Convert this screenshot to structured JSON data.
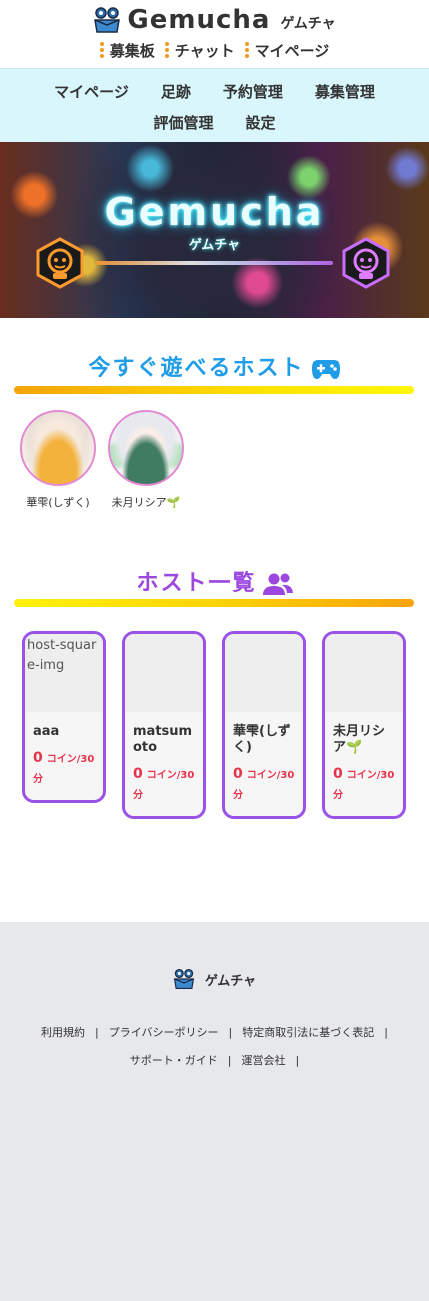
{
  "header": {
    "logo_text": "Gemucha",
    "logo_kana": "ゲムチャ",
    "links": [
      "募集板",
      "チャット",
      "マイページ"
    ]
  },
  "nav": {
    "row1": [
      "マイページ",
      "足跡",
      "予約管理",
      "募集管理"
    ],
    "row2": [
      "評価管理",
      "設定"
    ]
  },
  "banner": {
    "title": "Gemucha",
    "kana": "ゲムチャ"
  },
  "available": {
    "title": "今すぐ遊べるホスト",
    "hosts": [
      {
        "name": "華雫(しずく)"
      },
      {
        "name": "未月リシア🌱"
      }
    ]
  },
  "host_list": {
    "title": "ホスト一覧",
    "cards": [
      {
        "name": "aaa",
        "price": "0",
        "unit": "コイン/30分",
        "img_alt": "host-square-img"
      },
      {
        "name": "matsumoto",
        "price": "0",
        "unit": "コイン/30分"
      },
      {
        "name": "華雫(しずく)",
        "price": "0",
        "unit": "コイン/30分"
      },
      {
        "name": "未月リシア🌱",
        "price": "0",
        "unit": "コイン/30分"
      }
    ]
  },
  "footer": {
    "logo_text": "ゲムチャ",
    "links_row1": [
      "利用規約",
      "プライバシーポリシー",
      "特定商取引法に基づく表記"
    ],
    "links_row2": [
      "サポート・ガイド",
      "運営会社"
    ]
  },
  "colors": {
    "accent_orange": "#f39a1e",
    "nav_bg": "#d9f6fc",
    "title_blue": "#1f9de8",
    "title_purple": "#9b47e0",
    "card_border": "#9b52e6",
    "price_red": "#e8324a",
    "footer_bg": "#e7e8ec"
  },
  "icons": [
    "frog-logo-icon",
    "gamepad-icon",
    "users-icon",
    "headset-robot-icon"
  ]
}
